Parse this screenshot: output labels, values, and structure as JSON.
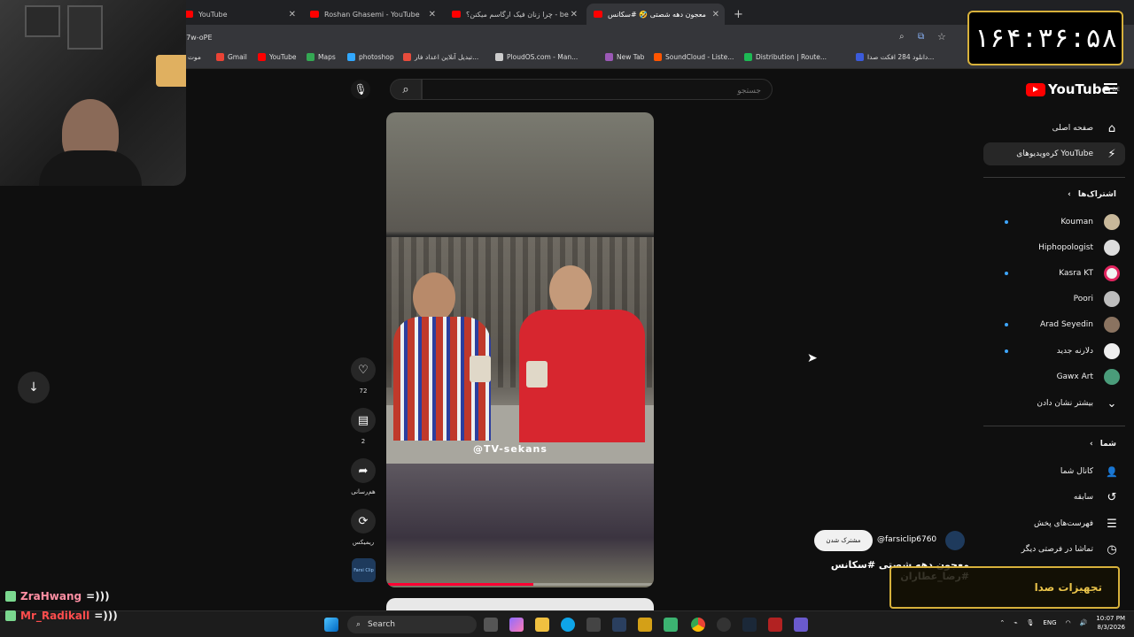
{
  "browser": {
    "tabs": [
      {
        "label": "YouTube"
      },
      {
        "label": "Roshan Ghasemi - YouTube"
      },
      {
        "label": "چرا زنان فیک ارگاسم میکنن؟ - be"
      },
      {
        "label": "معجون دهه شصتی 🤣 #سکانس"
      }
    ],
    "new_tab_symbol": "+",
    "url": "77w-oPE",
    "bookmarks": [
      {
        "label": "موت",
        "color": "#888888"
      },
      {
        "label": "Gmail",
        "color": "#ea4335"
      },
      {
        "label": "YouTube",
        "color": "#ff0000"
      },
      {
        "label": "Maps",
        "color": "#34a853"
      },
      {
        "label": "photoshop",
        "color": "#31a8ff"
      },
      {
        "label": "تبدیل آنلاین اعداد فار...",
        "color": "#e74c3c"
      },
      {
        "label": "PloudOS.com - Man...",
        "color": "#cccccc"
      },
      {
        "label": "New Tab",
        "color": "#9b59b6"
      },
      {
        "label": "SoundCloud - Liste...",
        "color": "#ff5500"
      },
      {
        "label": "Distribution | Route...",
        "color": "#1db954"
      },
      {
        "label": "دانلود 284 افکت صدا...",
        "color": "#3b5bdb"
      }
    ]
  },
  "clock": {
    "time": "۱۶۴:۳۶:۵۸"
  },
  "youtube": {
    "logo_text": "YouTube",
    "region": "DE",
    "search_placeholder": "جستجو",
    "nav": [
      {
        "label": "صفحه اصلی",
        "icon": "home-icon",
        "glyph": "⌂"
      },
      {
        "label": "کره‌ویدیوهای YouTube",
        "icon": "shorts-icon",
        "glyph": "⚡"
      }
    ],
    "subscriptions_header": "اشتراک‌ها",
    "subscriptions": [
      {
        "label": "Kouman",
        "new": true
      },
      {
        "label": "Hiphopologist",
        "new": false
      },
      {
        "label": "Kasra KT",
        "new": true
      },
      {
        "label": "Poori",
        "new": false
      },
      {
        "label": "Arad Seyedin",
        "new": true
      },
      {
        "label": "دلارنه جدید",
        "new": true
      },
      {
        "label": "Gawx Art",
        "new": false
      }
    ],
    "show_more": "بیشتر نشان دادن",
    "you_header": "شما",
    "you_items": [
      {
        "label": "کانال شما",
        "icon": "person-icon",
        "glyph": "👤"
      },
      {
        "label": "سابقه",
        "icon": "history-icon",
        "glyph": "↺"
      },
      {
        "label": "فهرست‌های پخش",
        "icon": "playlist-icon",
        "glyph": "☰"
      },
      {
        "label": "تماشا در فرصتی دیگر",
        "icon": "clock-icon",
        "glyph": "◷"
      }
    ],
    "short": {
      "watermark": "@TV-sekans",
      "progress": 0.55,
      "likes": "72",
      "comments": "2",
      "share_label": "هم‌رسانی",
      "remix_label": "ریمیکس",
      "channel_avatar_text": "Farsi Clip",
      "subscribe_label": "مشترک شدن",
      "channel_handle": "@farsiclip6760",
      "title": "معجون دهه شصتی #سکانس #رضا_عطاران"
    }
  },
  "chat": [
    {
      "user": "ZraHwang",
      "msg": "=)))",
      "color": "#ff8fa3"
    },
    {
      "user": "Mr_Radikall",
      "msg": "=)))",
      "color": "#ff4d4d"
    }
  ],
  "audio_overlay": "تجهیزات صدا",
  "taskbar": {
    "search_label": "Search",
    "lang": "ENG",
    "time": "10:07 PM",
    "date": "8/3/2026"
  }
}
